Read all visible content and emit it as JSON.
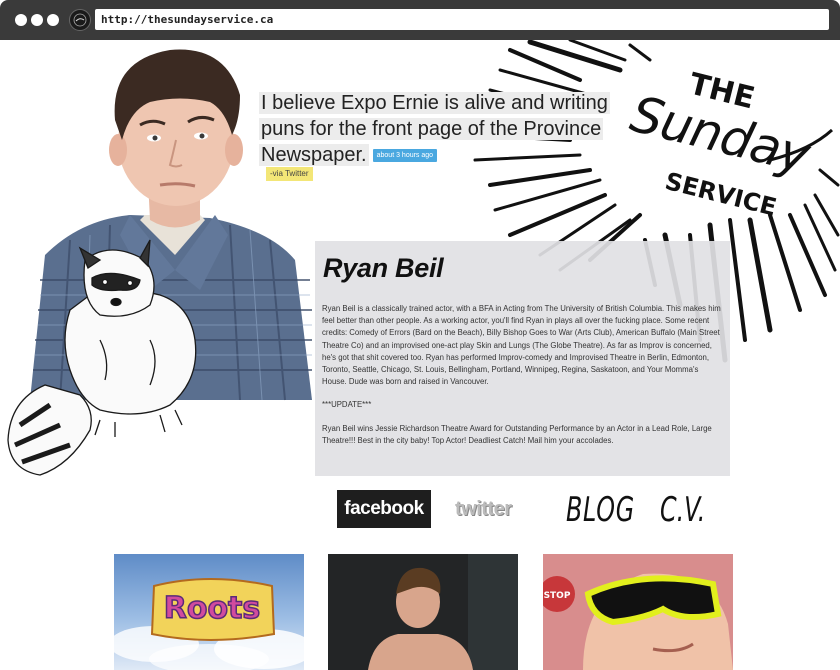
{
  "browser": {
    "url": "http://thesundayservice.ca"
  },
  "logo": {
    "line1": "THE",
    "line2": "Sunday",
    "line3": "SERVICE"
  },
  "tweet": {
    "text": "I believe Expo Ernie is alive and writing puns for the front page of the Province Newspaper.",
    "timestamp": "about 3 hours ago",
    "source": "-via Twitter"
  },
  "bio": {
    "name": "Ryan Beil",
    "paragraph": "Ryan Beil is a classically trained actor, with a BFA in Acting from The University of British Columbia. This makes him feel better than other people. As a working actor, you'll find Ryan in plays all over the fucking place. Some recent credits: Comedy of Errors (Bard on the Beach), Billy Bishop Goes to War (Arts Club), American Buffalo (Main Street Theatre Co) and an improvised one-act play Skin and Lungs (The Globe Theatre). As far as Improv is concerned, he's got that shit covered too. Ryan has performed Improv-comedy and Improvised Theatre in Berlin, Edmonton, Toronto, Seattle, Chicago, St. Louis, Bellingham, Portland, Winnipeg, Regina, Saskatoon, and Your Momma's House. Dude was born and raised in Vancouver.",
    "update_heading": "***UPDATE***",
    "update_text": "Ryan Beil wins Jessie Richardson Theatre Award for Outstanding Performance by an Actor in a Lead Role, Large Theatre!!! Best in the city baby! Top Actor! Deadliest Catch! Mail him your accolades."
  },
  "social": {
    "facebook": "facebook",
    "twitter": "twitter",
    "blog": "BLOG",
    "cv": "C.V."
  },
  "thumbnails": {
    "roots_title": "Roots",
    "stop_sign": "STOP"
  },
  "colors": {
    "chrome": "#3a3a3a",
    "tweet_bg": "#ececec",
    "timestamp_badge": "#4aa8e0",
    "via_badge": "#f3e677",
    "bio_bg": "#e1e1e4"
  }
}
